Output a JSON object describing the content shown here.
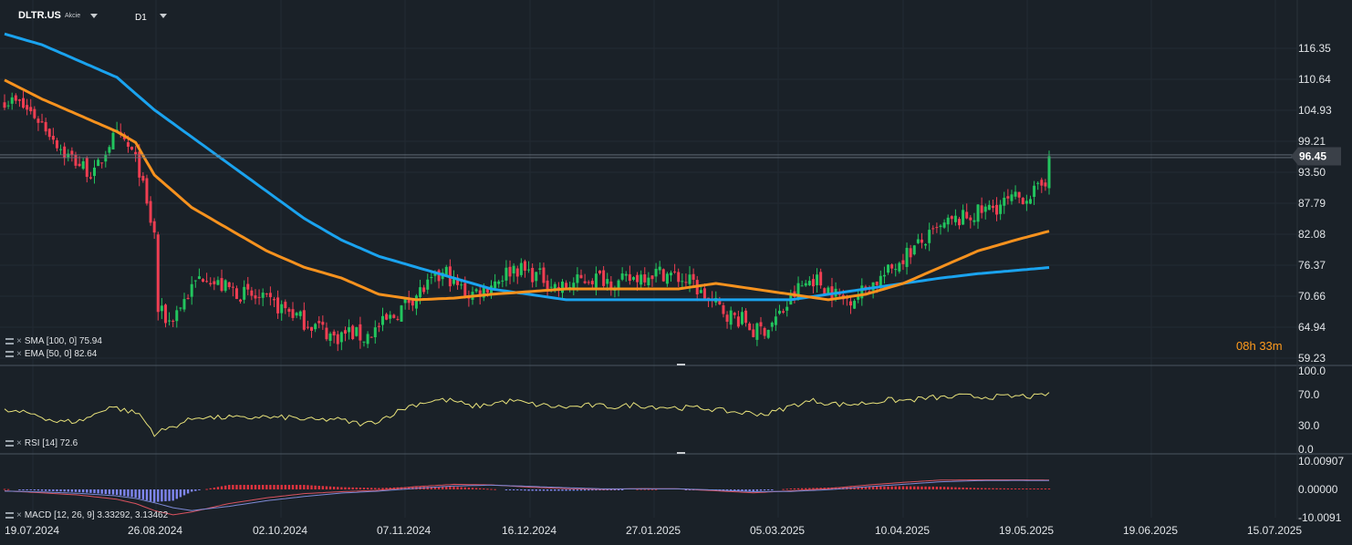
{
  "header": {
    "symbol": "DLTR.US",
    "symbol_type": "Akcie",
    "timeframe": "D1"
  },
  "countdown": {
    "hours": "08",
    "h_unit": "h",
    "minutes": "33",
    "m_unit": "m"
  },
  "indicators": {
    "sma_label": "SMA [100, 0] 75.94",
    "ema_label": "EMA [50, 0] 82.64",
    "rsi_label": "RSI [14] 72.6",
    "macd_label": "MACD [12, 26, 9] 3.33292, 3.13462"
  },
  "colors": {
    "background": "#1a2128",
    "bull_candle": "#22c55e",
    "bear_candle": "#ef3e52",
    "sma": "#1aa3ef",
    "ema": "#f7921e",
    "rsi": "#e8e27a",
    "macd_line": "#d9525e",
    "signal_line": "#7d8ad6",
    "hist_pos": "#e0343f",
    "hist_neg": "#7f86f0",
    "price_tag": "#3a4048"
  },
  "chart_data": [
    {
      "type": "candlestick",
      "panel": "price",
      "y_ticks": [
        "116.35",
        "110.64",
        "104.93",
        "99.21",
        "93.50",
        "87.79",
        "82.08",
        "76.37",
        "70.66",
        "64.94",
        "59.23"
      ],
      "ylim": [
        59.23,
        119.5
      ],
      "current_price": "96.45",
      "x_labels": [
        "19.07.2024",
        "26.08.2024",
        "02.10.2024",
        "07.11.2024",
        "16.12.2024",
        "27.01.2025",
        "05.03.2025",
        "10.04.2025",
        "19.05.2025",
        "19.06.2025",
        "15.07.2025"
      ],
      "close_path": [
        [
          0,
          107
        ],
        [
          4,
          106
        ],
        [
          8,
          104
        ],
        [
          12,
          101
        ],
        [
          16,
          97
        ],
        [
          20,
          95
        ],
        [
          24,
          93
        ],
        [
          26,
          96
        ],
        [
          28,
          99
        ],
        [
          30,
          100
        ],
        [
          32,
          99
        ],
        [
          34,
          97
        ],
        [
          36,
          94
        ],
        [
          38,
          87
        ],
        [
          40,
          82
        ],
        [
          41,
          68
        ],
        [
          44,
          66
        ],
        [
          48,
          70
        ],
        [
          52,
          74
        ],
        [
          54,
          75
        ],
        [
          56,
          73
        ],
        [
          60,
          72
        ],
        [
          64,
          71
        ],
        [
          68,
          70
        ],
        [
          72,
          69
        ],
        [
          76,
          68
        ],
        [
          80,
          66
        ],
        [
          84,
          65
        ],
        [
          88,
          63
        ],
        [
          92,
          64
        ],
        [
          96,
          63
        ],
        [
          100,
          65
        ],
        [
          104,
          67
        ],
        [
          108,
          70
        ],
        [
          112,
          72
        ],
        [
          116,
          74
        ],
        [
          118,
          75
        ],
        [
          120,
          73
        ],
        [
          124,
          71
        ],
        [
          128,
          72
        ],
        [
          132,
          74
        ],
        [
          136,
          76
        ],
        [
          140,
          75
        ],
        [
          144,
          74
        ],
        [
          148,
          72
        ],
        [
          152,
          73
        ],
        [
          156,
          74
        ],
        [
          160,
          74
        ],
        [
          164,
          73
        ],
        [
          168,
          74
        ],
        [
          172,
          75
        ],
        [
          176,
          75
        ],
        [
          180,
          74
        ],
        [
          184,
          73
        ],
        [
          186,
          71
        ],
        [
          190,
          69
        ],
        [
          194,
          67
        ],
        [
          198,
          66
        ],
        [
          200,
          64
        ],
        [
          204,
          65
        ],
        [
          208,
          68
        ],
        [
          212,
          72
        ],
        [
          216,
          74
        ],
        [
          220,
          72
        ],
        [
          224,
          70
        ],
        [
          228,
          71
        ],
        [
          232,
          73
        ],
        [
          236,
          75
        ],
        [
          240,
          78
        ],
        [
          244,
          80
        ],
        [
          248,
          82
        ],
        [
          252,
          84
        ],
        [
          256,
          85
        ],
        [
          260,
          86
        ],
        [
          264,
          87
        ],
        [
          268,
          88
        ],
        [
          272,
          89
        ],
        [
          276,
          90
        ],
        [
          278,
          92
        ],
        [
          279,
          96.45
        ]
      ],
      "sma_100": [
        [
          0,
          119
        ],
        [
          10,
          117
        ],
        [
          20,
          114
        ],
        [
          30,
          111
        ],
        [
          40,
          105
        ],
        [
          50,
          100
        ],
        [
          60,
          95
        ],
        [
          70,
          90
        ],
        [
          80,
          85
        ],
        [
          90,
          81
        ],
        [
          100,
          78
        ],
        [
          110,
          76
        ],
        [
          120,
          74
        ],
        [
          130,
          72
        ],
        [
          140,
          71
        ],
        [
          150,
          70
        ],
        [
          160,
          70
        ],
        [
          170,
          70
        ],
        [
          180,
          70
        ],
        [
          190,
          70
        ],
        [
          200,
          70
        ],
        [
          210,
          70
        ],
        [
          220,
          71
        ],
        [
          230,
          72
        ],
        [
          240,
          73
        ],
        [
          250,
          74
        ],
        [
          260,
          74.8
        ],
        [
          270,
          75.4
        ],
        [
          279,
          75.94
        ]
      ],
      "ema_50": [
        [
          0,
          110.5
        ],
        [
          10,
          107
        ],
        [
          20,
          104
        ],
        [
          30,
          101
        ],
        [
          35,
          99
        ],
        [
          40,
          93
        ],
        [
          50,
          87
        ],
        [
          60,
          83
        ],
        [
          70,
          79
        ],
        [
          80,
          76
        ],
        [
          90,
          74
        ],
        [
          100,
          71
        ],
        [
          110,
          70
        ],
        [
          120,
          70.3
        ],
        [
          130,
          71
        ],
        [
          140,
          71.5
        ],
        [
          150,
          72
        ],
        [
          160,
          72
        ],
        [
          170,
          72
        ],
        [
          180,
          72
        ],
        [
          190,
          73
        ],
        [
          200,
          72
        ],
        [
          210,
          71
        ],
        [
          220,
          70
        ],
        [
          230,
          71
        ],
        [
          240,
          73
        ],
        [
          250,
          76
        ],
        [
          260,
          79
        ],
        [
          270,
          81
        ],
        [
          279,
          82.64
        ]
      ]
    },
    {
      "type": "line",
      "panel": "rsi",
      "y_ticks": [
        "100.0",
        "70.0",
        "30.0",
        "0.0"
      ],
      "ylim": [
        0,
        100
      ],
      "values": [
        [
          0,
          49
        ],
        [
          8,
          45
        ],
        [
          14,
          35
        ],
        [
          20,
          36
        ],
        [
          24,
          44
        ],
        [
          28,
          55
        ],
        [
          32,
          50
        ],
        [
          36,
          45
        ],
        [
          40,
          20
        ],
        [
          44,
          27
        ],
        [
          48,
          35
        ],
        [
          52,
          42
        ],
        [
          56,
          40
        ],
        [
          60,
          41
        ],
        [
          64,
          39
        ],
        [
          68,
          42
        ],
        [
          72,
          40
        ],
        [
          76,
          41
        ],
        [
          80,
          38
        ],
        [
          84,
          37
        ],
        [
          88,
          39
        ],
        [
          92,
          35
        ],
        [
          96,
          32
        ],
        [
          100,
          37
        ],
        [
          104,
          46
        ],
        [
          108,
          55
        ],
        [
          112,
          60
        ],
        [
          116,
          63
        ],
        [
          120,
          62
        ],
        [
          124,
          55
        ],
        [
          128,
          56
        ],
        [
          132,
          60
        ],
        [
          136,
          62
        ],
        [
          140,
          58
        ],
        [
          144,
          56
        ],
        [
          148,
          54
        ],
        [
          152,
          54
        ],
        [
          156,
          56
        ],
        [
          160,
          55
        ],
        [
          164,
          54
        ],
        [
          168,
          57
        ],
        [
          172,
          55
        ],
        [
          176,
          54
        ],
        [
          180,
          53
        ],
        [
          184,
          53
        ],
        [
          188,
          52
        ],
        [
          192,
          49
        ],
        [
          196,
          47
        ],
        [
          200,
          46
        ],
        [
          204,
          45
        ],
        [
          208,
          52
        ],
        [
          212,
          58
        ],
        [
          216,
          62
        ],
        [
          220,
          59
        ],
        [
          224,
          57
        ],
        [
          228,
          58
        ],
        [
          232,
          60
        ],
        [
          236,
          63
        ],
        [
          240,
          62
        ],
        [
          244,
          64
        ],
        [
          248,
          66
        ],
        [
          252,
          66
        ],
        [
          256,
          68
        ],
        [
          260,
          67
        ],
        [
          264,
          67
        ],
        [
          268,
          67
        ],
        [
          272,
          68
        ],
        [
          276,
          67
        ],
        [
          279,
          72.6
        ]
      ]
    },
    {
      "type": "macd",
      "panel": "macd",
      "y_ticks": [
        "10.00907",
        "0.00000",
        "-10.0091"
      ],
      "ylim": [
        -10.0091,
        10.00907
      ],
      "macd_line": [
        [
          0,
          -0.5
        ],
        [
          10,
          -1.2
        ],
        [
          20,
          -2
        ],
        [
          30,
          -3.5
        ],
        [
          35,
          -5
        ],
        [
          40,
          -7.5
        ],
        [
          45,
          -9
        ],
        [
          50,
          -8
        ],
        [
          60,
          -5
        ],
        [
          70,
          -3
        ],
        [
          80,
          -1.5
        ],
        [
          90,
          -0.8
        ],
        [
          100,
          -0.3
        ],
        [
          110,
          1
        ],
        [
          120,
          1.8
        ],
        [
          130,
          1.6
        ],
        [
          140,
          0.8
        ],
        [
          150,
          0.3
        ],
        [
          160,
          0
        ],
        [
          170,
          0.3
        ],
        [
          180,
          0.2
        ],
        [
          190,
          -0.5
        ],
        [
          200,
          -1.2
        ],
        [
          210,
          -0.5
        ],
        [
          220,
          0.3
        ],
        [
          230,
          1.5
        ],
        [
          240,
          2.5
        ],
        [
          250,
          3.3
        ],
        [
          260,
          3.4
        ],
        [
          270,
          3.4
        ],
        [
          279,
          3.33292
        ]
      ],
      "signal_line": [
        [
          0,
          -0.6
        ],
        [
          10,
          -0.9
        ],
        [
          20,
          -1.4
        ],
        [
          30,
          -2.3
        ],
        [
          35,
          -3.2
        ],
        [
          40,
          -4.7
        ],
        [
          45,
          -6.5
        ],
        [
          50,
          -7.5
        ],
        [
          60,
          -6
        ],
        [
          70,
          -4
        ],
        [
          80,
          -2.5
        ],
        [
          90,
          -1.3
        ],
        [
          100,
          -0.6
        ],
        [
          110,
          0.4
        ],
        [
          120,
          1.2
        ],
        [
          130,
          1.5
        ],
        [
          140,
          1.1
        ],
        [
          150,
          0.6
        ],
        [
          160,
          0.2
        ],
        [
          170,
          0.2
        ],
        [
          180,
          0.2
        ],
        [
          190,
          -0.2
        ],
        [
          200,
          -0.8
        ],
        [
          210,
          -0.7
        ],
        [
          220,
          -0.1
        ],
        [
          230,
          0.9
        ],
        [
          240,
          1.8
        ],
        [
          250,
          2.7
        ],
        [
          260,
          3.1
        ],
        [
          270,
          3.2
        ],
        [
          279,
          3.13462
        ]
      ]
    }
  ]
}
